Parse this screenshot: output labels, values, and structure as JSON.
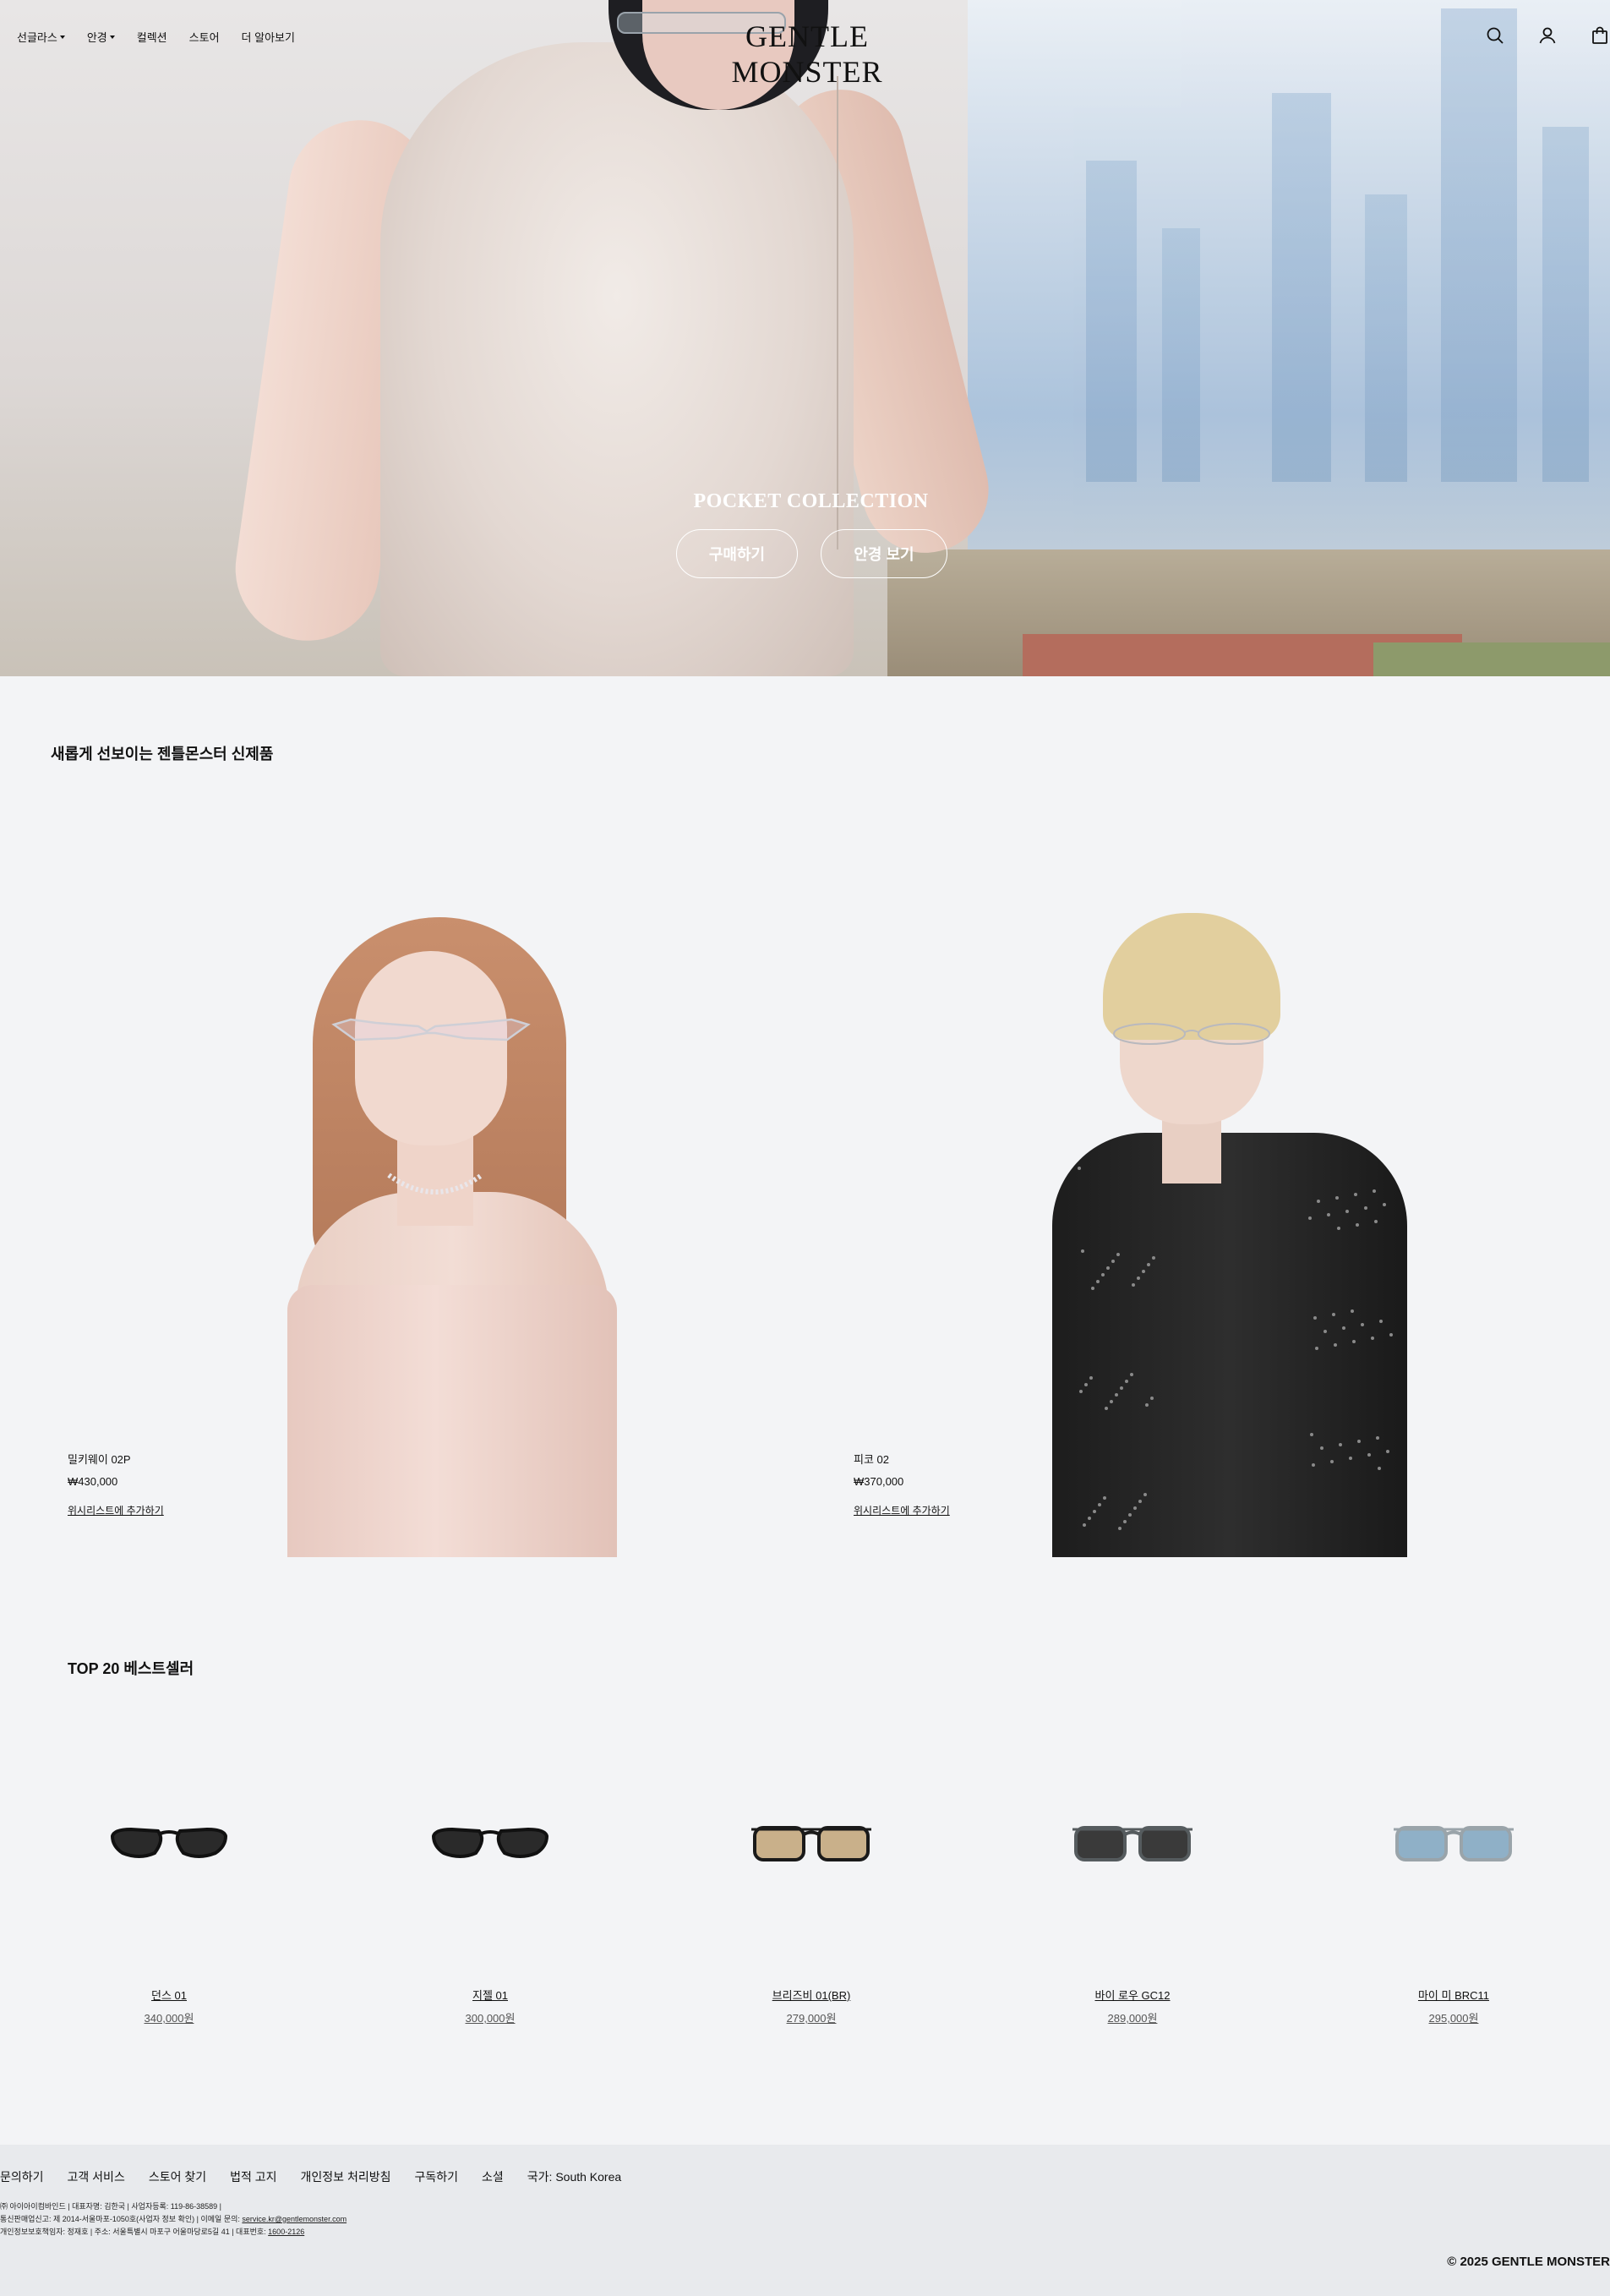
{
  "nav": {
    "items": [
      {
        "label": "선글라스",
        "has_caret": true
      },
      {
        "label": "안경",
        "has_caret": true
      },
      {
        "label": "컬렉션",
        "has_caret": false
      },
      {
        "label": "스토어",
        "has_caret": false
      },
      {
        "label": "더 알아보기",
        "has_caret": false
      }
    ],
    "logo": "GENTLE MONSTER",
    "icons": [
      "search-icon",
      "account-icon",
      "bag-icon"
    ]
  },
  "hero": {
    "title": "POCKET COLLECTION",
    "buy_label": "구매하기",
    "view_label": "안경 보기"
  },
  "new_arrivals": {
    "title": "새롭게 선보이는 젠틀몬스터 신제품",
    "products": [
      {
        "name": "밀키웨이 02P",
        "price": "₩430,000",
        "wishlist": "위시리스트에 추가하기"
      },
      {
        "name": "피코 02",
        "price": "₩370,000",
        "wishlist": "위시리스트에 추가하기"
      }
    ]
  },
  "bestsellers": {
    "title": "TOP 20 베스트셀러",
    "items": [
      {
        "name": "던스 01",
        "price": "340,000원",
        "lens_color": "#2a2a2a",
        "frame_color": "#111111"
      },
      {
        "name": "지젤 01",
        "price": "300,000원",
        "lens_color": "#2a2a2a",
        "frame_color": "#111111"
      },
      {
        "name": "브리즈비 01(BR)",
        "price": "279,000원",
        "lens_color": "#c9b08a",
        "frame_color": "#1a1a1a"
      },
      {
        "name": "바이 로우 GC12",
        "price": "289,000원",
        "lens_color": "#3a3a3a",
        "frame_color": "#555b5e"
      },
      {
        "name": "마이 미 BRC11",
        "price": "295,000원",
        "lens_color": "#8fb0c7",
        "frame_color": "#9aa4aa"
      }
    ]
  },
  "footer": {
    "links": [
      "문의하기",
      "고객 서비스",
      "스토어 찾기",
      "법적 고지",
      "개인정보 처리방침",
      "구독하기",
      "소셜",
      "국가: South Korea"
    ],
    "info_line1": "㈜ 아이아이컴바인드 | 대표자명: 김한국 | 사업자등록: 119-86-38589 |",
    "info_line2_prefix": "통신판매업신고: 제 2014-서울마포-1050호(사업자 정보 확인) | 이메일 문의: ",
    "email": "service.kr@gentlemonster.com",
    "info_line3_prefix": "개인정보보호책임자: 정재호 | 주소: 서울특별시 마포구 어울마당로5길 41 | 대표번호: ",
    "phone": "1600-2126",
    "copyright": "© 2025 GENTLE MONSTER"
  }
}
